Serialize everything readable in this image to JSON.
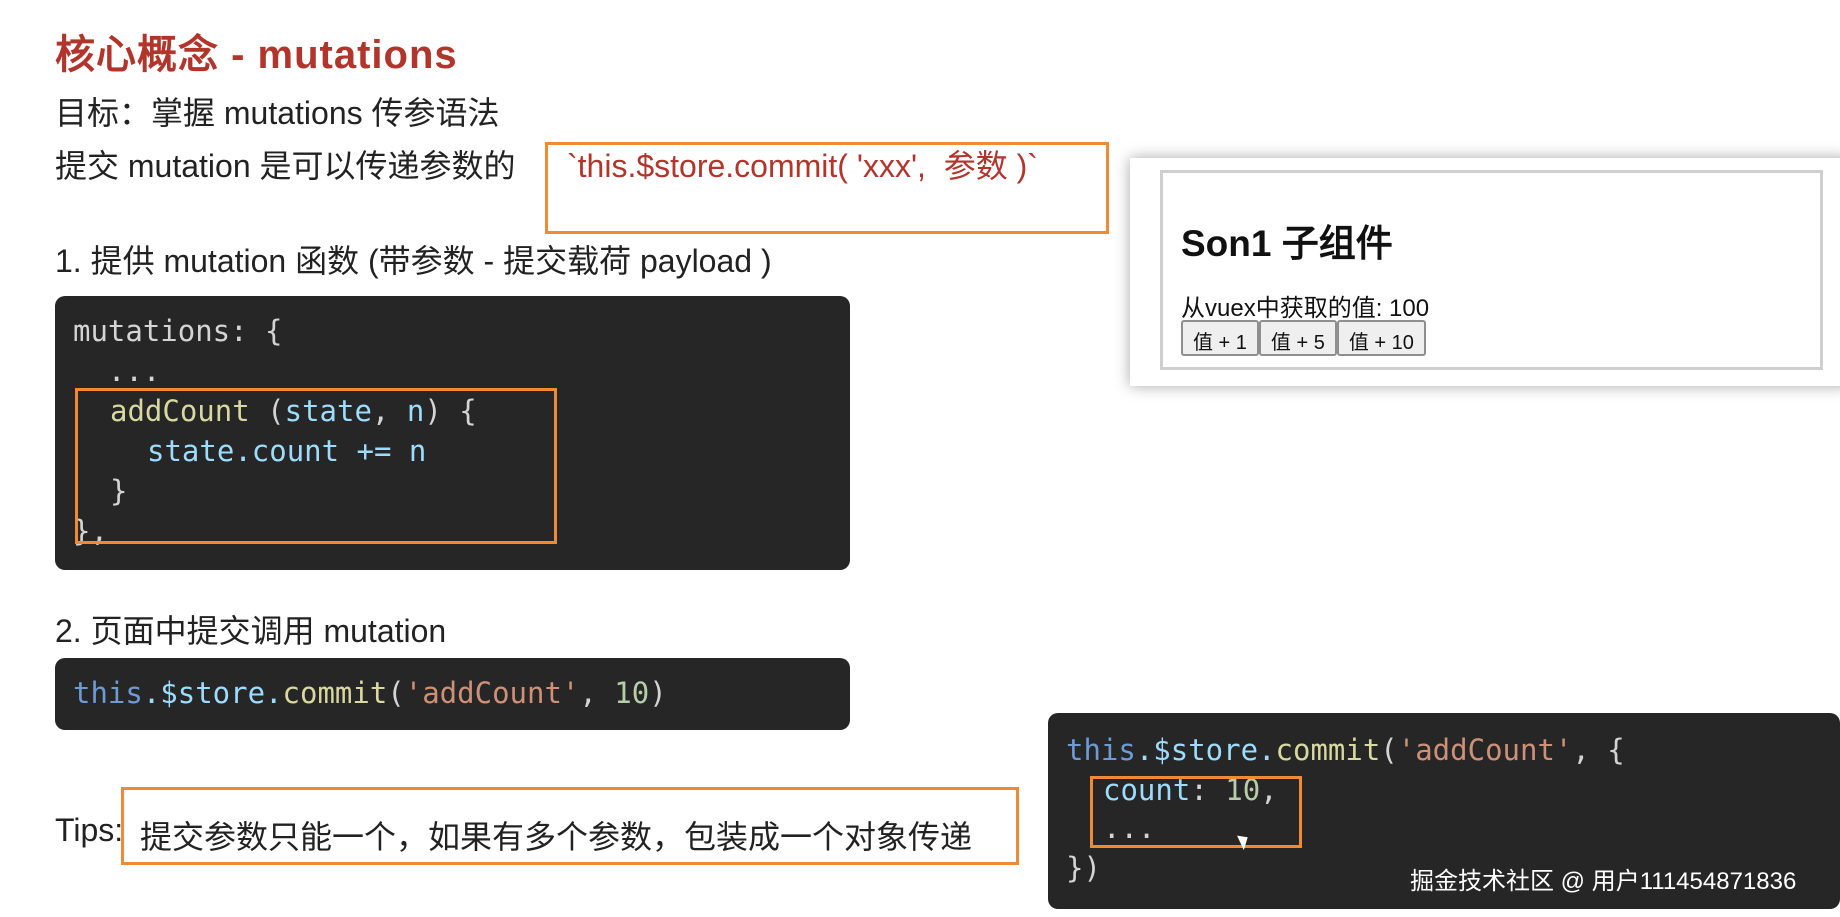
{
  "title": "核心概念 - mutations",
  "goal": "目标：掌握 mutations 传参语法",
  "intro": {
    "text": "提交 mutation 是可以传递参数的",
    "code": "`this.$store.commit( 'xxx',  参数 )`"
  },
  "step1": "1. 提供 mutation 函数 (带参数 - 提交载荷 payload )",
  "code1": {
    "line1": "mutations: {",
    "line2": "  ...",
    "line3_fn": "addCount",
    "line3_a": " (",
    "line3_state": "state",
    "line3_b": ", ",
    "line3_n": "n",
    "line3_c": ") {",
    "line4_a": "state",
    "line4_b": ".count += ",
    "line4_n": "n",
    "line5": "}",
    "line6": "},"
  },
  "step2": "2. 页面中提交调用 mutation",
  "code2": {
    "this": "this",
    "store": ".$store.",
    "commit": "commit",
    "open": "(",
    "arg": "'addCount'",
    "sep": ", ",
    "num": "10",
    "close": ")"
  },
  "tips": {
    "label": "Tips:",
    "text": "提交参数只能一个，如果有多个参数，包装成一个对象传递"
  },
  "code3": {
    "this": "this",
    "store": ".$store.",
    "commit": "commit",
    "open": "(",
    "arg": "'addCount'",
    "rest": ", {",
    "count_key": "count",
    "count_colon": ": ",
    "count_val": "10",
    "count_comma": ",",
    "dots": "...",
    "end": "})"
  },
  "demo": {
    "title": "Son1 子组件",
    "value_text": "从vuex中获取的值: 100",
    "buttons": [
      "值 + 1",
      "值 + 5",
      "值 + 10"
    ]
  },
  "watermark": "掘金技术社区 @ 用户111454871836",
  "colors": {
    "title": "#b2352c",
    "highlight_border": "#f08a35",
    "code_bg": "#262626"
  }
}
